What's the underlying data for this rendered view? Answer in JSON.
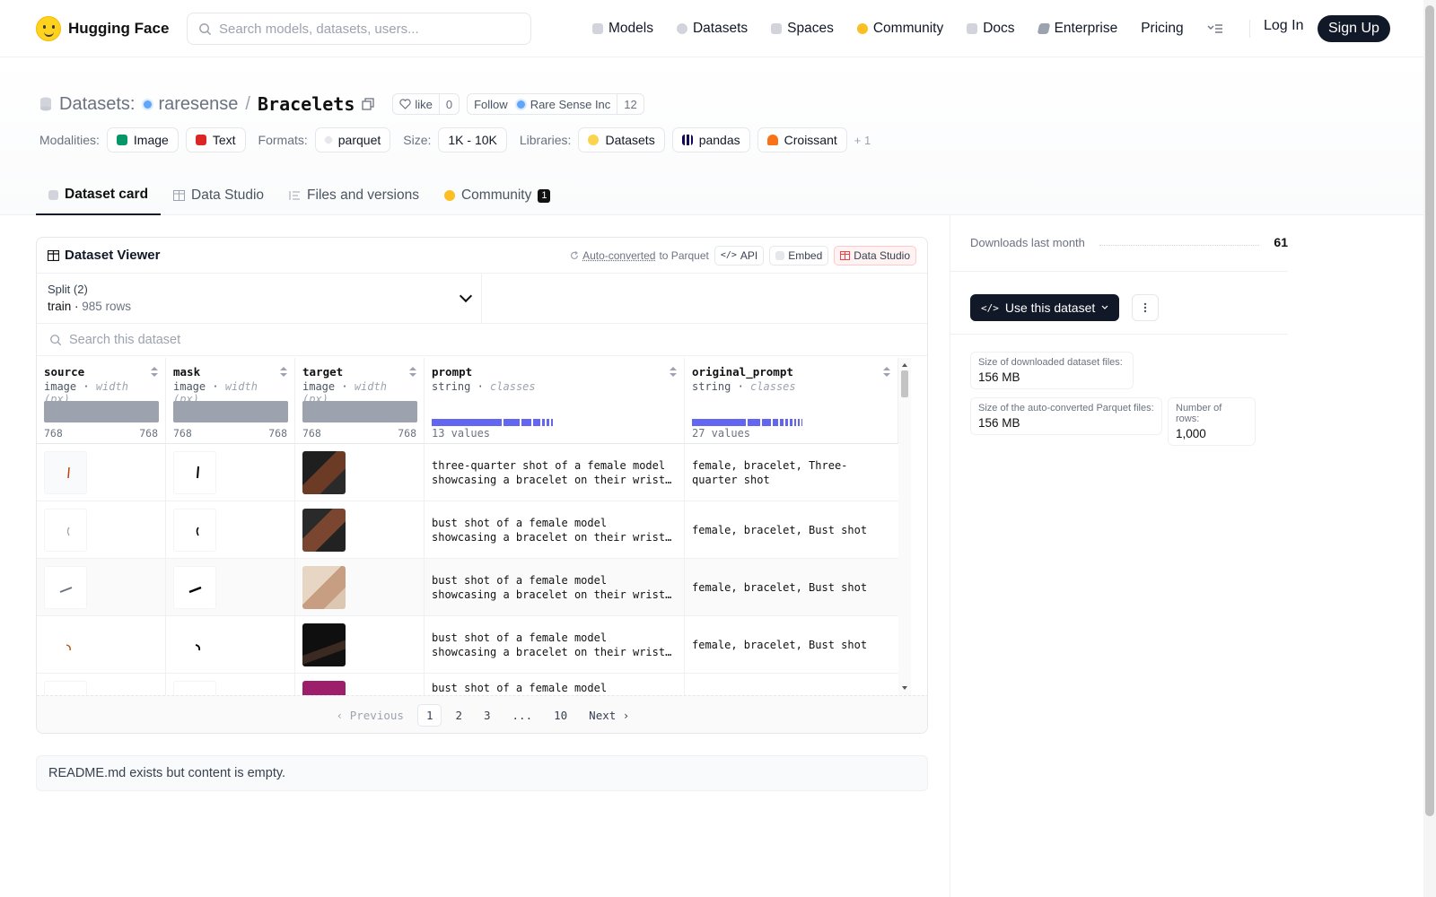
{
  "nav": {
    "brand": "Hugging Face",
    "search_placeholder": "Search models, datasets, users...",
    "links": [
      "Models",
      "Datasets",
      "Spaces",
      "Community",
      "Docs",
      "Enterprise",
      "Pricing"
    ],
    "login": "Log In",
    "signup": "Sign Up"
  },
  "header": {
    "datasets_label": "Datasets:",
    "owner": "raresense",
    "separator": "/",
    "repo": "Bracelets",
    "like_label": "like",
    "like_count": "0",
    "follow_label": "Follow",
    "follow_org": "Rare Sense Inc",
    "follow_count": "12",
    "modalities_label": "Modalities:",
    "modalities": [
      "Image",
      "Text"
    ],
    "formats_label": "Formats:",
    "format": "parquet",
    "size_label": "Size:",
    "size": "1K - 10K",
    "libraries_label": "Libraries:",
    "libraries": [
      "Datasets",
      "pandas",
      "Croissant"
    ],
    "libraries_more": "+ 1"
  },
  "tabs": {
    "dataset_card": "Dataset card",
    "data_studio": "Data Studio",
    "files": "Files and versions",
    "community": "Community",
    "community_count": "1"
  },
  "viewer": {
    "title": "Dataset Viewer",
    "auto_converted": "Auto-converted",
    "to_parquet": "to Parquet",
    "api": "API",
    "embed": "Embed",
    "data_studio": "Data Studio",
    "split_label": "Split (2)",
    "split_value": "train",
    "split_rows": "985 rows",
    "search_placeholder": "Search this dataset",
    "columns": [
      {
        "name": "source",
        "type": "image",
        "sub": "width (px)",
        "min": "768",
        "max": "768"
      },
      {
        "name": "mask",
        "type": "image",
        "sub": "width (px)",
        "min": "768",
        "max": "768"
      },
      {
        "name": "target",
        "type": "image",
        "sub": "width (px)",
        "min": "768",
        "max": "768"
      },
      {
        "name": "prompt",
        "type": "string",
        "sub": "classes",
        "values": "13 values"
      },
      {
        "name": "original_prompt",
        "type": "string",
        "sub": "classes",
        "values": "27 values"
      }
    ],
    "rows": [
      {
        "prompt": "three-quarter shot of a female model showcasing a bracelet on their wrist; realistic photo",
        "original_prompt": "female, bracelet, Three-quarter shot"
      },
      {
        "prompt": "bust shot of a female model showcasing a bracelet on their wrist; realistic photo",
        "original_prompt": "female, bracelet, Bust shot"
      },
      {
        "prompt": "bust shot of a female model showcasing a bracelet on their wrist; realistic photo",
        "original_prompt": "female, bracelet, Bust shot"
      },
      {
        "prompt": "bust shot of a female model showcasing a bracelet on their wrist; realistic photo",
        "original_prompt": "female, bracelet, Bust shot"
      },
      {
        "prompt": "bust shot of a female model showcasing",
        "original_prompt": ""
      }
    ],
    "pager": {
      "previous": "Previous",
      "pages": [
        "1",
        "2",
        "3",
        "...",
        "10"
      ],
      "next": "Next"
    }
  },
  "readme": "README.md exists but content is empty.",
  "sidebar": {
    "downloads_label": "Downloads last month",
    "downloads_value": "61",
    "use_dataset": "Use this dataset",
    "size_downloaded_label": "Size of downloaded dataset files:",
    "size_downloaded_value": "156 MB",
    "size_parquet_label": "Size of the auto-converted Parquet files:",
    "size_parquet_value": "156 MB",
    "num_rows_label": "Number of rows:",
    "num_rows_value": "1,000"
  }
}
